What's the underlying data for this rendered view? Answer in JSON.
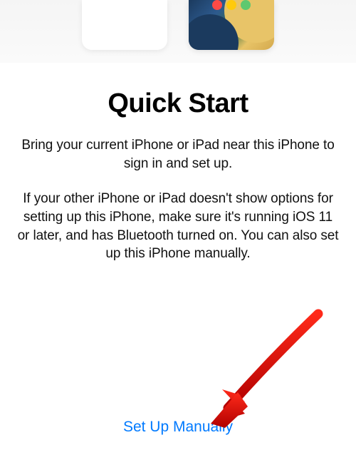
{
  "title": "Quick Start",
  "paragraph1": "Bring your current iPhone or iPad near this iPhone to sign in and set up.",
  "paragraph2": "If your other iPhone or iPad doesn't show options for setting up this iPhone, make sure it's running iOS 11 or later, and has Bluetooth turned on. You can also set up this iPhone manually.",
  "manual_button": "Set Up Manually",
  "colors": {
    "link": "#007aff",
    "arrow": "#d80000"
  }
}
